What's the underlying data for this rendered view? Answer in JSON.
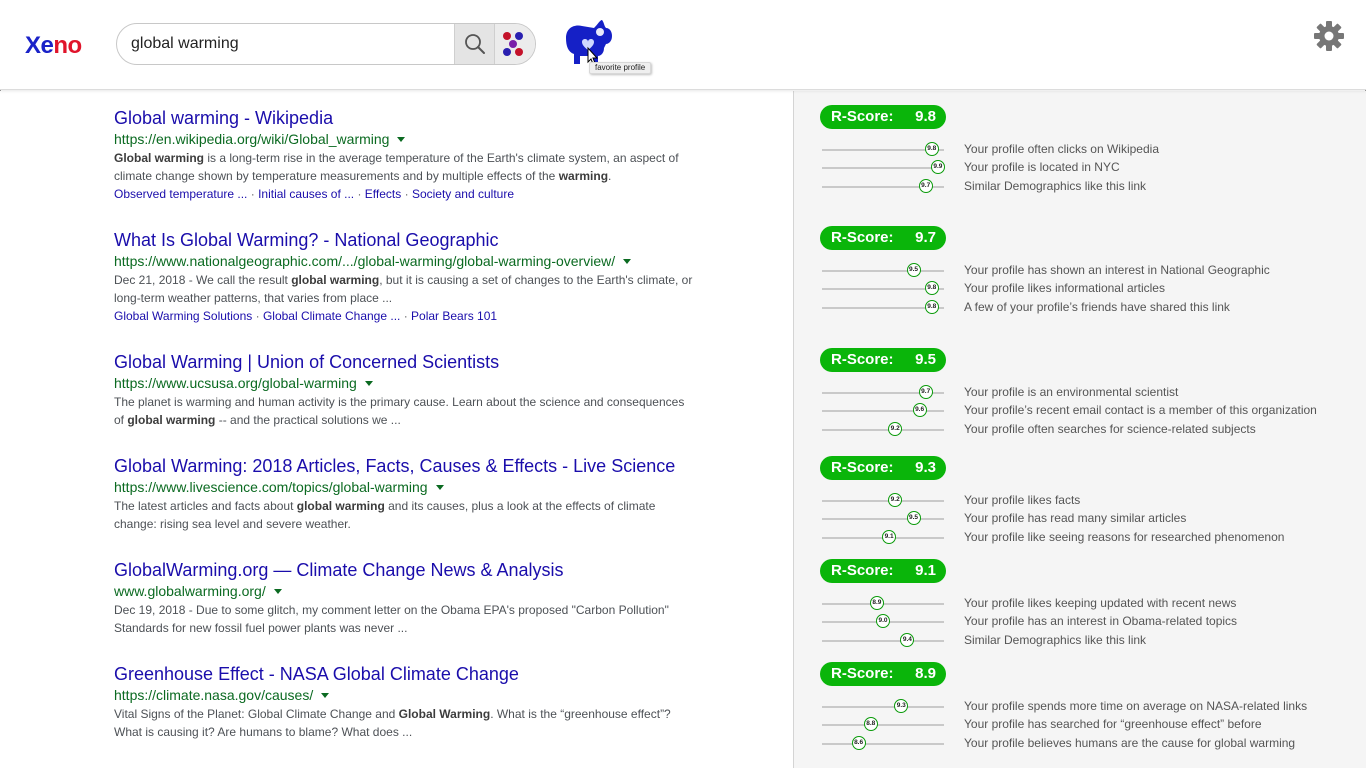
{
  "app": {
    "logo_part1": "Xe",
    "logo_part2": "no"
  },
  "search": {
    "query": "global warming"
  },
  "profile": {
    "tooltip": "favorite profile"
  },
  "results": [
    {
      "title": "Global warming - Wikipedia",
      "url": "https://en.wikipedia.org/wiki/Global_warming",
      "desc_html": "<b>Global warming</b> is a long-term rise in the average temperature of the Earth's climate system, an aspect of climate change shown by temperature measurements and by multiple effects of the <b>warming</b>.",
      "links": [
        "Observed temperature ...",
        "Initial causes of ...",
        "Effects",
        "Society and culture"
      ]
    },
    {
      "title": "What Is Global Warming? - National Geographic",
      "url": "https://www.nationalgeographic.com/.../global-warming/global-warming-overview/",
      "desc_html": "Dec 21, 2018 - We call the result <b>global warming</b>, but it is causing a set of changes to the Earth's climate, or long-term weather patterns, that varies from place ...",
      "links": [
        "Global Warming Solutions",
        "Global Climate Change ...",
        "Polar Bears 101"
      ]
    },
    {
      "title": "Global Warming | Union of Concerned Scientists",
      "url": "https://www.ucsusa.org/global-warming",
      "desc_html": "The planet is warming and human activity is the primary cause. Learn about the science and consequences of <b>global warming</b> -- and the practical solutions we ...",
      "links": []
    },
    {
      "title": "Global Warming: 2018 Articles, Facts, Causes & Effects - Live Science",
      "url": "https://www.livescience.com/topics/global-warming",
      "desc_html": "The latest articles and facts about <b>global warming</b> and its causes, plus a look at the effects of climate change: rising sea level and severe weather.",
      "links": []
    },
    {
      "title": "GlobalWarming.org — Climate Change News & Analysis",
      "url": "www.globalwarming.org/",
      "desc_html": "Dec 19, 2018 - Due to some glitch, my comment letter on the Obama EPA's proposed \"Carbon Pollution\" Standards for new fossil fuel power plants was never ...",
      "links": []
    },
    {
      "title": "Greenhouse Effect - NASA Global Climate Change",
      "url": "https://climate.nasa.gov/causes/",
      "desc_html": "Vital Signs of the Planet: Global Climate Change and <b>Global Warming</b>. What is the “greenhouse effect”? What is causing it? Are humans to blame? What does ...",
      "links": []
    }
  ],
  "scores": [
    {
      "label": "R-Score:",
      "value": "9.8",
      "factors": [
        {
          "score": "9.8",
          "text": "Your profile often clicks on Wikipedia"
        },
        {
          "score": "9.9",
          "text": "Your profile is located in NYC"
        },
        {
          "score": "9.7",
          "text": "Similar Demographics like this link"
        }
      ]
    },
    {
      "label": "R-Score:",
      "value": "9.7",
      "factors": [
        {
          "score": "9.5",
          "text": "Your profile has shown an interest in National Geographic"
        },
        {
          "score": "9.8",
          "text": "Your profile likes informational articles"
        },
        {
          "score": "9.8",
          "text": "A few of your profile’s friends have shared this link"
        }
      ]
    },
    {
      "label": "R-Score:",
      "value": "9.5",
      "factors": [
        {
          "score": "9.7",
          "text": "Your profile is an environmental scientist"
        },
        {
          "score": "9.6",
          "text": "Your profile’s recent email contact is a member of this organization"
        },
        {
          "score": "9.2",
          "text": "Your profile often searches for science-related subjects"
        }
      ]
    },
    {
      "label": "R-Score:",
      "value": "9.3",
      "factors": [
        {
          "score": "9.2",
          "text": "Your profile likes facts"
        },
        {
          "score": "9.5",
          "text": "Your profile has read many similar articles"
        },
        {
          "score": "9.1",
          "text": "Your profile like seeing reasons for researched phenomenon"
        }
      ]
    },
    {
      "label": "R-Score:",
      "value": "9.1",
      "factors": [
        {
          "score": "8.9",
          "text": "Your profile likes keeping updated with recent news"
        },
        {
          "score": "9.0",
          "text": "Your profile has an interest in Obama-related topics"
        },
        {
          "score": "9.4",
          "text": "Similar Demographics like this link"
        }
      ]
    },
    {
      "label": "R-Score:",
      "value": "8.9",
      "factors": [
        {
          "score": "9.3",
          "text": "Your profile spends more time on average on NASA-related links"
        },
        {
          "score": "8.8",
          "text": "Your profile has searched for “greenhouse effect” before"
        },
        {
          "score": "8.6",
          "text": "Your profile believes humans are the cause for global warming"
        }
      ]
    }
  ]
}
